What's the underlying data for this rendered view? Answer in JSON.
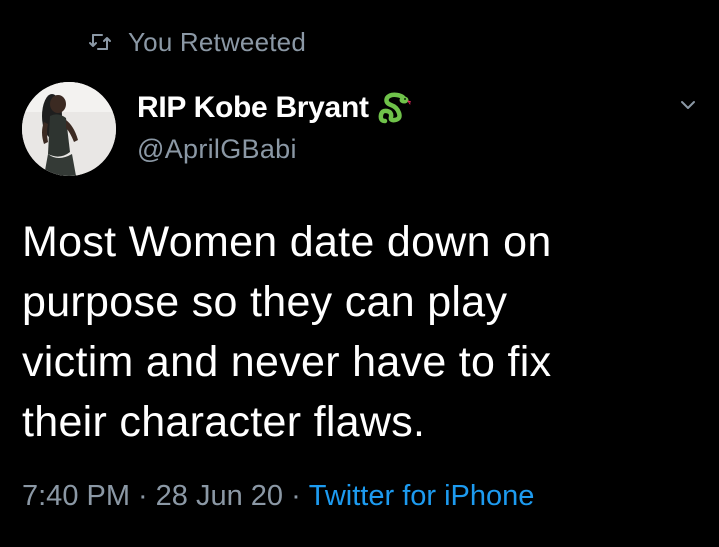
{
  "retweet": {
    "icon": "retweet-icon",
    "label": "You Retweeted"
  },
  "author": {
    "display_name": "RIP Kobe Bryant",
    "name_emoji": "snake-icon",
    "handle": "@AprilGBabi",
    "avatar": "avatar"
  },
  "menu": {
    "icon": "chevron-down-icon"
  },
  "tweet": {
    "lines": [
      "Most Women date down on",
      "purpose so they can play",
      "victim and never have to fix",
      "their character flaws."
    ]
  },
  "meta": {
    "time": "7:40 PM",
    "separator": "·",
    "date": "28 Jun 20",
    "source": "Twitter for iPhone"
  },
  "colors": {
    "background": "#000000",
    "primary_text": "#ffffff",
    "secondary_text": "#8b98a5",
    "link": "#1d9bf0",
    "snake_green": "#6fc24a"
  }
}
